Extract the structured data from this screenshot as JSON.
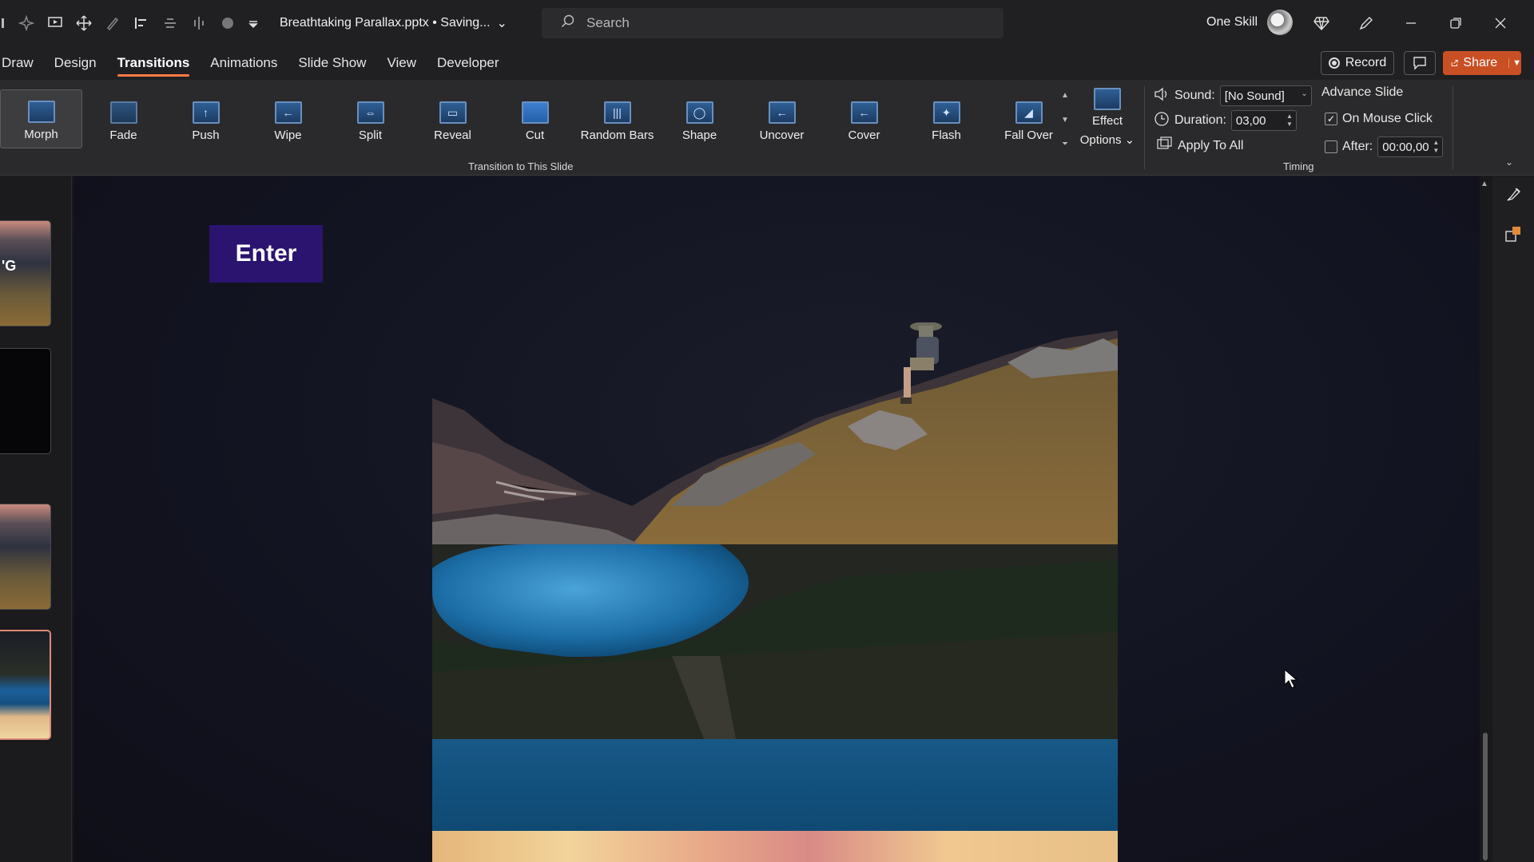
{
  "titlebar": {
    "document_title": "Breathtaking Parallax.pptx • Saving...",
    "search_placeholder": "Search",
    "user_name": "One Skill"
  },
  "tabs": [
    {
      "label": "Draw"
    },
    {
      "label": "Design"
    },
    {
      "label": "Transitions",
      "active": true
    },
    {
      "label": "Animations"
    },
    {
      "label": "Slide Show"
    },
    {
      "label": "View"
    },
    {
      "label": "Developer"
    }
  ],
  "actions": {
    "record_label": "Record",
    "share_label": "Share"
  },
  "ribbon": {
    "transitions": [
      {
        "label": "Morph",
        "icon": "morph-icon",
        "selected": true
      },
      {
        "label": "Fade",
        "icon": "fade-icon"
      },
      {
        "label": "Push",
        "icon": "push-icon"
      },
      {
        "label": "Wipe",
        "icon": "wipe-icon"
      },
      {
        "label": "Split",
        "icon": "split-icon"
      },
      {
        "label": "Reveal",
        "icon": "reveal-icon"
      },
      {
        "label": "Cut",
        "icon": "cut-icon"
      },
      {
        "label": "Random Bars",
        "icon": "random-bars-icon"
      },
      {
        "label": "Shape",
        "icon": "shape-icon"
      },
      {
        "label": "Uncover",
        "icon": "uncover-icon"
      },
      {
        "label": "Cover",
        "icon": "cover-icon"
      },
      {
        "label": "Flash",
        "icon": "flash-icon"
      },
      {
        "label": "Fall Over",
        "icon": "fall-over-icon"
      }
    ],
    "effect_options_line1": "Effect",
    "effect_options_line2": "Options",
    "transition_group_label": "Transition to This Slide",
    "timing": {
      "sound_label": "Sound:",
      "sound_value": "[No Sound]",
      "duration_label": "Duration:",
      "duration_value": "03,00",
      "apply_all_label": "Apply To All",
      "advance_slide_label": "Advance Slide",
      "on_mouse_click_label": "On Mouse Click",
      "on_mouse_click_checked": true,
      "after_label": "After:",
      "after_value": "00:00,00",
      "after_checked": false,
      "group_label": "Timing"
    }
  },
  "slide": {
    "enter_label": "Enter",
    "enter_color": "#2a1470"
  },
  "thumbnails": {
    "first_thumb_text": "'G"
  },
  "colors": {
    "accent": "#ff7a45",
    "share": "#c94f25",
    "gallery_icon": "#2f5f95"
  }
}
